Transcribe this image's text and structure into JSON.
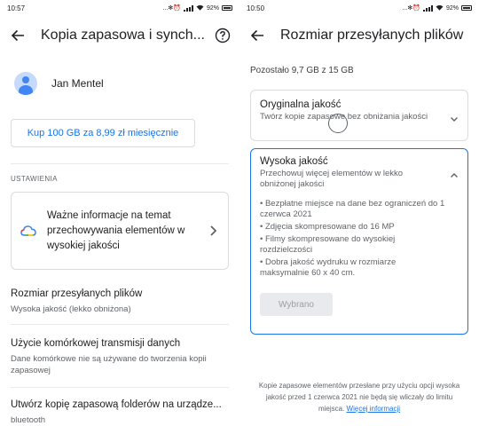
{
  "left": {
    "status": {
      "time": "10:57",
      "icons": "...✻⏰",
      "battery": "92%"
    },
    "title": "Kopia zapasowa i synch...",
    "account_name": "Jan Mentel",
    "buy_button": "Kup 100 GB za 8,99 zł miesięcznie",
    "section_label": "USTAWIENIA",
    "info_card_text": "Ważne informacje na temat przechowywania elementów w wysokiej jakości",
    "settings": [
      {
        "title": "Rozmiar przesyłanych plików",
        "sub": "Wysoka jakość (lekko obniżona)"
      },
      {
        "title": "Użycie komórkowej transmisji danych",
        "sub": "Dane komórkowe nie są używane do tworzenia kopii zapasowej"
      },
      {
        "title": "Utwórz kopię zapasową folderów na urządze...",
        "sub": "bluetooth"
      }
    ]
  },
  "right": {
    "status": {
      "time": "10:50",
      "icons": "...✻⏰",
      "battery": "92%"
    },
    "title": "Rozmiar przesyłanych plików",
    "remaining": "Pozostało 9,7 GB z 15 GB",
    "original": {
      "title": "Oryginalna jakość",
      "sub": "Twórz kopie zapasowe bez obniżania jakości"
    },
    "high": {
      "title": "Wysoka jakość",
      "sub": "Przechowuj więcej elementów w lekko obniżonej jakości",
      "bullets": [
        "• Bezpłatne miejsce na dane bez ograniczeń do 1 czerwca 2021",
        "• Zdjęcia skompresowane do 16 MP",
        "• Filmy skompresowane do wysokiej rozdzielczości",
        "• Dobra jakość wydruku w rozmiarze maksymalnie 60 x 40 cm."
      ],
      "button": "Wybrano"
    },
    "footer_text": "Kopie zapasowe elementów przesłane przy użyciu opcji wysoka jakość przed 1 czerwca 2021 nie będą się wliczały do limitu miejsca.",
    "footer_link": "Więcej informacji"
  },
  "colors": {
    "accent": "#1a73e8",
    "text": "#202124",
    "secondary": "#5f6368",
    "border": "#dadce0"
  }
}
